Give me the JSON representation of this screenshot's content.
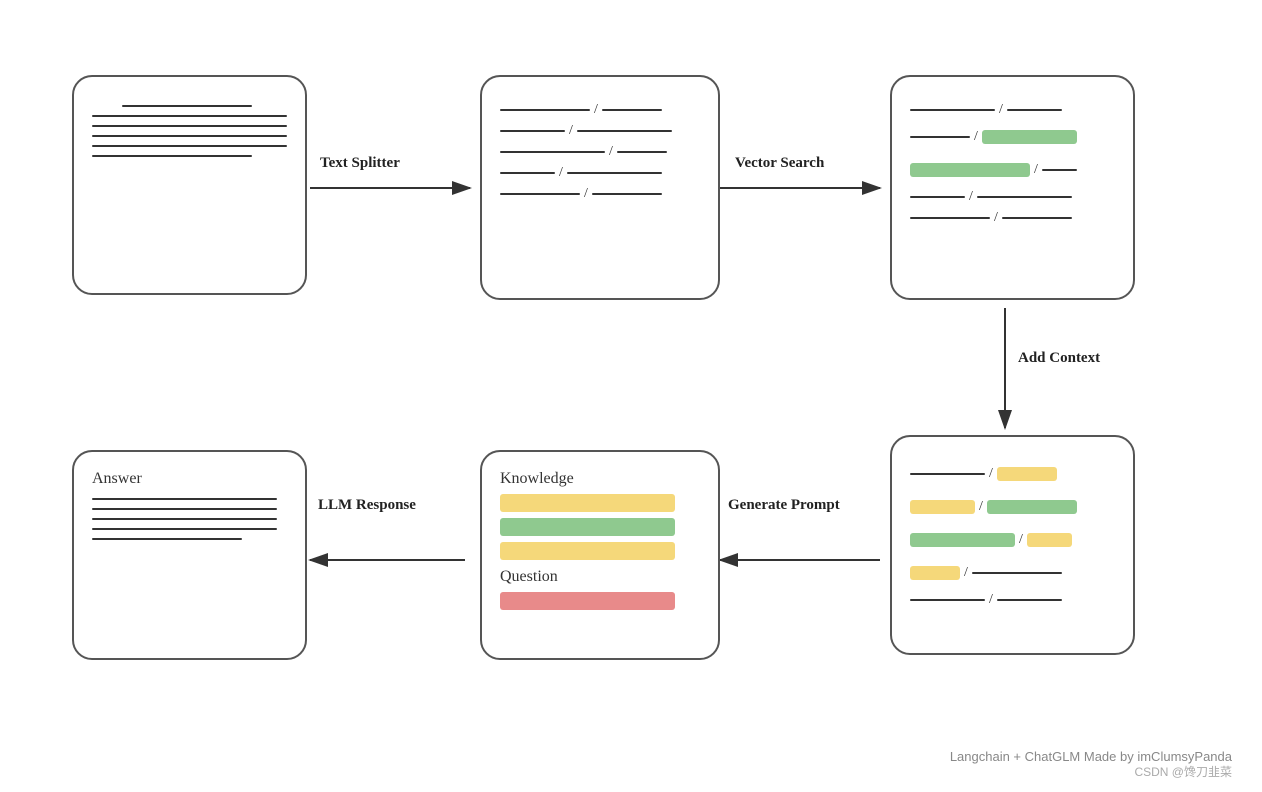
{
  "arrows": {
    "text_splitter": "Text Splitter",
    "vector_search": "Vector Search",
    "add_context": "Add Context",
    "llm_response": "LLM Response",
    "generate_prompt": "Generate Prompt"
  },
  "cards": {
    "doc": {
      "id": "card-doc"
    },
    "chunks": {
      "id": "card-chunks"
    },
    "search": {
      "id": "card-search"
    },
    "context": {
      "id": "card-context"
    },
    "knowledge": {
      "id": "card-knowledge",
      "label1": "Knowledge",
      "label2": "Question"
    },
    "answer": {
      "id": "card-answer",
      "label": "Answer"
    }
  },
  "watermark": "Langchain + ChatGLM Made by imClumsyPanda",
  "brand": "CSDN @馋刀韭菜"
}
